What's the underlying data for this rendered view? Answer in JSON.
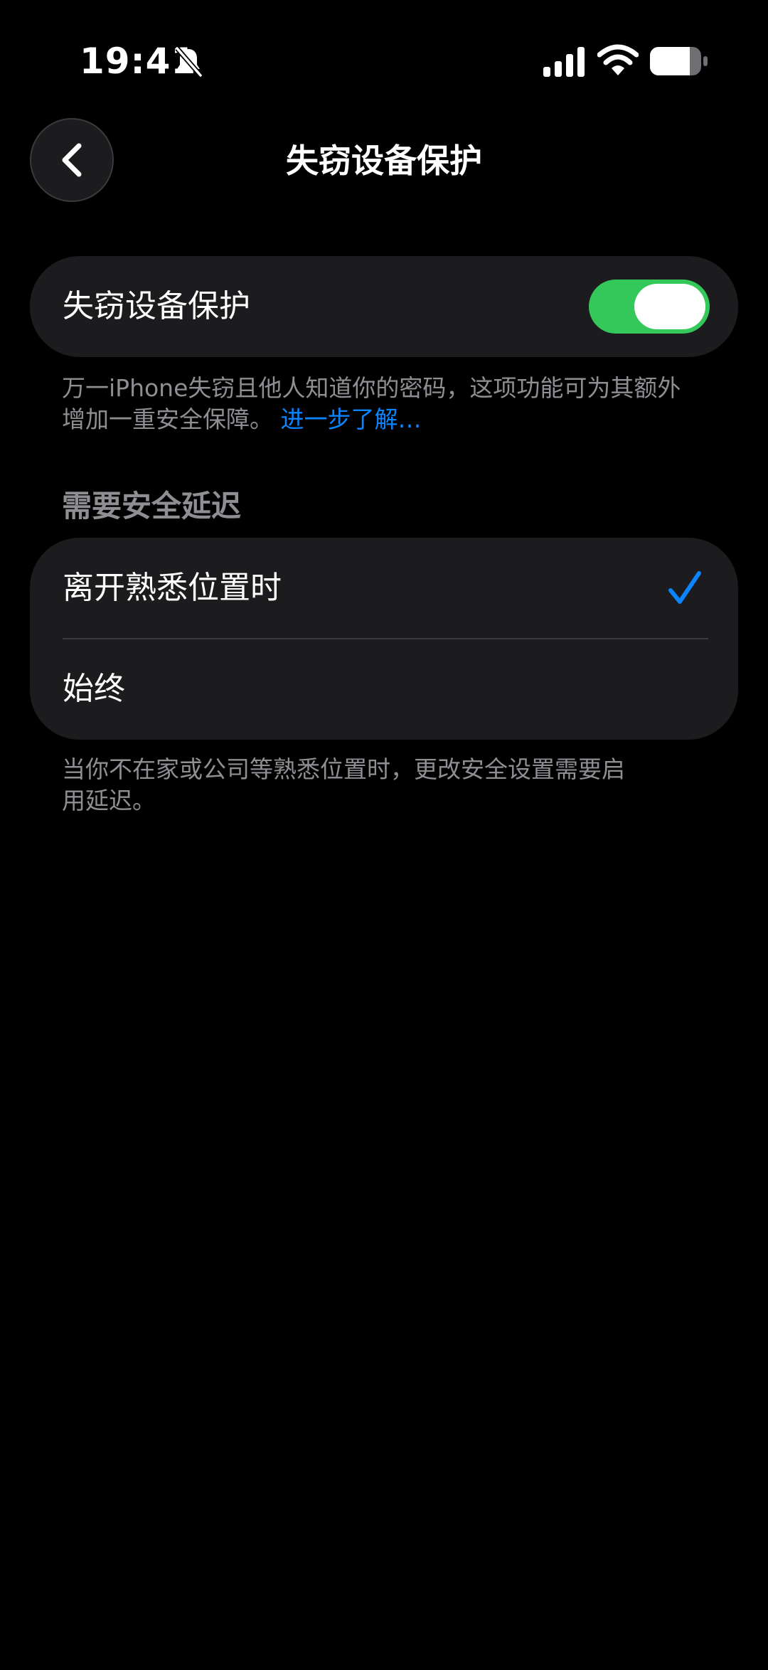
{
  "status_bar": {
    "time": "19:41",
    "icons": [
      "bell-slash-icon",
      "cellular-signal-icon",
      "wifi-icon",
      "battery-icon"
    ]
  },
  "nav": {
    "back_icon": "chevron-left-icon",
    "title": "失窃设备保护"
  },
  "protection": {
    "label": "失窃设备保护",
    "enabled": true,
    "footnote": "万一iPhone失窃且他人知道你的密码，这项功能可为其额外增加一重安全保障。",
    "learn_more": "进一步了解…"
  },
  "security_delay": {
    "header": "需要安全延迟",
    "options": [
      {
        "label": "离开熟悉位置时",
        "selected": true
      },
      {
        "label": "始终",
        "selected": false
      }
    ],
    "footnote": "当你不在家或公司等熟悉位置时，更改安全设置需要启用延迟。"
  },
  "colors": {
    "background": "#000000",
    "group_background": "#1c1c1e",
    "toggle_on": "#34c759",
    "accent": "#0a84ff",
    "secondary_text": "#8e8e93"
  }
}
